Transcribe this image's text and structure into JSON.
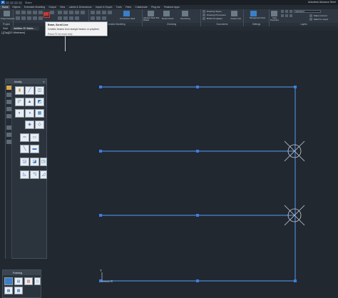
{
  "window": {
    "app_badge": "A",
    "share_label": "Share",
    "title": "Autodesk Advance Steel"
  },
  "ribbon_tabs": [
    "Home",
    "Objects",
    "Extended Modeling",
    "Output",
    "View",
    "Labels & Dimensions",
    "Import & Export",
    "Tools",
    "Parts",
    "Collaborate",
    "Plug-ins",
    "Featured Apps"
  ],
  "ribbon": {
    "groups": [
      {
        "label": "Project"
      },
      {
        "label": "Objects"
      },
      {
        "label": "Extended Modeling"
      },
      {
        "label": "Checking"
      },
      {
        "label": "Documents"
      },
      {
        "label": "Settings"
      },
      {
        "label": "Layers"
      }
    ],
    "buttons": {
      "project_explorer": "Project Explorer",
      "connection_vault": "Connection Vault",
      "collision_check": "Advance Steel Tool Palette",
      "model_check": "Model Check",
      "numbering": "Numbering",
      "drawing_style": "Drawing Styles",
      "drawing_processes": "Drawing Processes",
      "bom_templates": "BOM Templates",
      "create_lists": "Create Lists",
      "management_tools": "Management Tools",
      "copy_properties": "Copy Properties",
      "layer_standard": "Standard",
      "match_layer": "Make Current",
      "match_to_layer": "Match to Layer"
    }
  },
  "document_tabs": [
    "Start",
    "Addition 2D Marks ..."
  ],
  "viewport_label": "[-][Top][2D Wireframe]",
  "tooltip": {
    "title": "Beam, Scroll Line",
    "description": "Creates beams from straight beams or polylines",
    "help": "Press F1 for more help"
  },
  "palettes": {
    "modify": {
      "title": "Modify",
      "close_glyph": "✕"
    },
    "framing": {
      "title": "Framing"
    }
  },
  "canvas": {
    "ucs_y_label": "Y",
    "ucs_x_label": "X"
  },
  "colors": {
    "canvas_bg": "#212830",
    "beam_line": "#4a86d4",
    "grip": "#3f7de0",
    "accent_red": "#e0302a"
  },
  "icons": [
    "application-logo-icon",
    "modify-tool-icon",
    "framing-tool-icon",
    "ucs-icon",
    "beam-grip-icon",
    "section-marker-icon"
  ]
}
